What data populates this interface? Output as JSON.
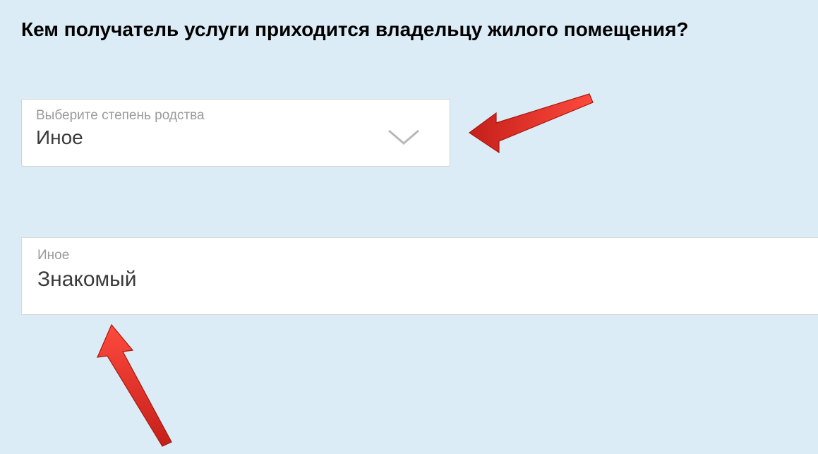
{
  "heading": "Кем получатель услуги приходится владельцу жилого помещения?",
  "select": {
    "label": "Выберите степень родства",
    "value": "Иное"
  },
  "textField": {
    "label": "Иное",
    "value": "Знакомый"
  },
  "arrowColor": "#e63228"
}
